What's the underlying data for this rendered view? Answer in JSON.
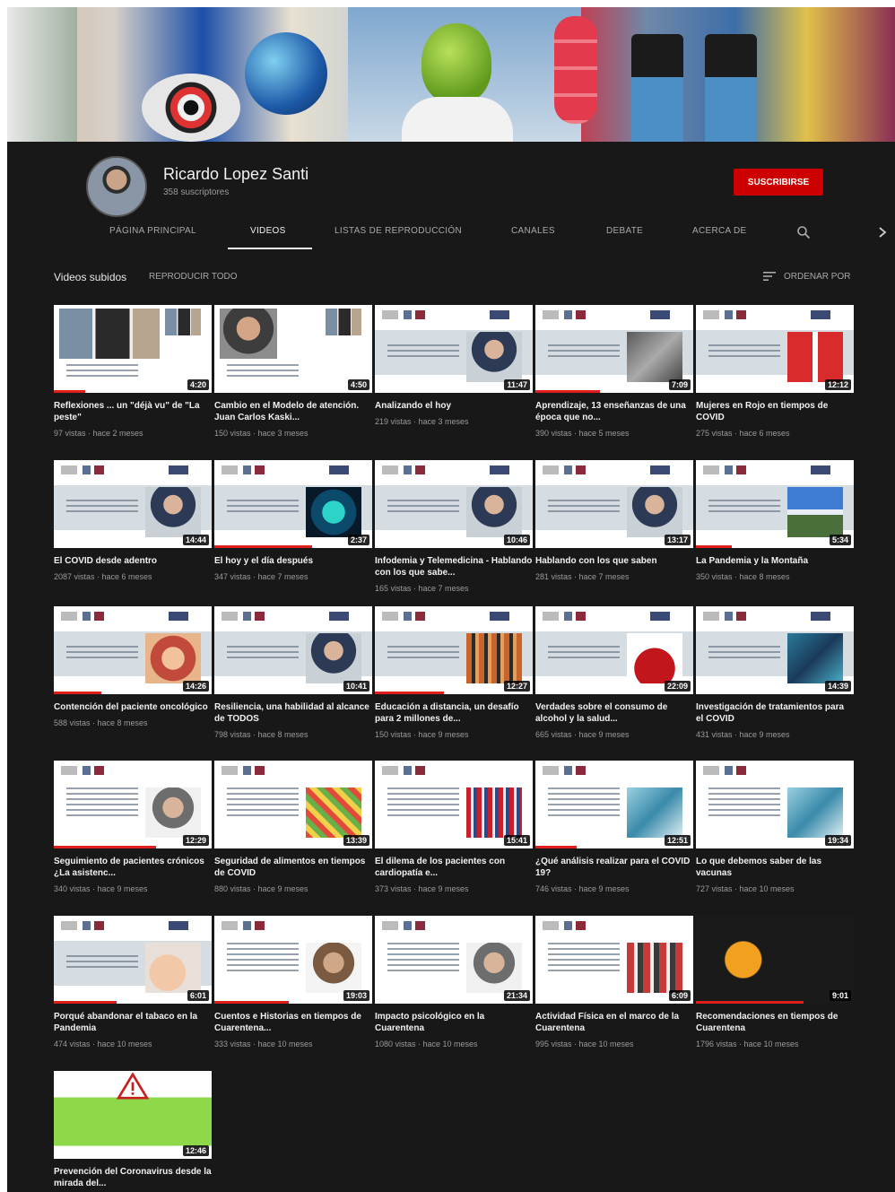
{
  "channel": {
    "name": "Ricardo Lopez Santi",
    "subscribers": "358 suscriptores",
    "subscribe_label": "SUSCRIBIRSE"
  },
  "tabs": [
    {
      "label": "PÁGINA PRINCIPAL"
    },
    {
      "label": "VIDEOS"
    },
    {
      "label": "LISTAS DE REPRODUCCIÓN"
    },
    {
      "label": "CANALES"
    },
    {
      "label": "DEBATE"
    },
    {
      "label": "ACERCA DE"
    }
  ],
  "section": {
    "title": "Videos subidos",
    "play_all": "REPRODUCIR TODO",
    "sort_label": "ORDENAR POR"
  },
  "colors": {
    "background": "#181818",
    "accent": "#cc0000",
    "text": "#f1f1f1",
    "muted": "#9a9a9a"
  },
  "videos": [
    {
      "title": "Reflexiones ... un \"déjà vu\" de \"La peste\"",
      "meta": "97 vistas · hace 2 meses",
      "duration": "4:20",
      "style": "photos"
    },
    {
      "title": "Cambio en el Modelo de atención. Juan Carlos Kaski...",
      "meta": "150 vistas · hace 3 meses",
      "duration": "4:50",
      "style": "portrait"
    },
    {
      "title": "Analizando el hoy",
      "meta": "219 vistas · hace 3 meses",
      "duration": "11:47",
      "style": "slide"
    },
    {
      "title": "Aprendizaje, 13 enseñanzas de una época que no...",
      "meta": "390 vistas · hace 5 meses",
      "duration": "7:09",
      "style": "slide-gray"
    },
    {
      "title": "Mujeres en Rojo en tiempos de COVID",
      "meta": "275 vistas · hace 6 meses",
      "duration": "12:12",
      "style": "slide-red"
    },
    {
      "title": "El COVID desde adentro",
      "meta": "2087 vistas · hace 6 meses",
      "duration": "14:44",
      "style": "slide"
    },
    {
      "title": "El hoy y el día después",
      "meta": "347 vistas · hace 7 meses",
      "duration": "2:37",
      "style": "slide-globe"
    },
    {
      "title": "Infodemia y Telemedicina - Hablando con los que sabe...",
      "meta": "165 vistas · hace 7 meses",
      "duration": "10:46",
      "style": "slide"
    },
    {
      "title": "Hablando con los que saben",
      "meta": "281 vistas · hace 7 meses",
      "duration": "13:17",
      "style": "slide"
    },
    {
      "title": "La Pandemia y la Montaña",
      "meta": "350 vistas · hace 8 meses",
      "duration": "5:34",
      "style": "slide-mountain"
    },
    {
      "title": "Contención del paciente oncológico",
      "meta": "588 vistas · hace 8 meses",
      "duration": "14:26",
      "style": "slide-hands"
    },
    {
      "title": "Resiliencia, una habilidad al alcance de TODOS",
      "meta": "798 vistas · hace 8 meses",
      "duration": "10:41",
      "style": "slide"
    },
    {
      "title": "Educación a distancia, un desafío para 2 millones de...",
      "meta": "150 vistas · hace 9 meses",
      "duration": "12:27",
      "style": "slide-crowd"
    },
    {
      "title": "Verdades sobre el consumo de alcohol y la salud...",
      "meta": "665 vistas · hace 9 meses",
      "duration": "22:09",
      "style": "slide-wine"
    },
    {
      "title": "Investigación de tratamientos para el COVID",
      "meta": "431 vistas · hace 9 meses",
      "duration": "14:39",
      "style": "slide-lab"
    },
    {
      "title": "Seguimiento de pacientes crónicos ¿La asistenc...",
      "meta": "340 vistas · hace 9 meses",
      "duration": "12:29",
      "style": "white"
    },
    {
      "title": "Seguridad de alimentos en tiempos de COVID",
      "meta": "880 vistas · hace 9 meses",
      "duration": "13:39",
      "style": "white-food"
    },
    {
      "title": "El dilema de los pacientes con cardiopatía e...",
      "meta": "373 vistas · hace 9 meses",
      "duration": "15:41",
      "style": "white-crowd"
    },
    {
      "title": "¿Qué análisis realizar para el COVID 19?",
      "meta": "746 vistas · hace 9 meses",
      "duration": "12:51",
      "style": "white-lab"
    },
    {
      "title": "Lo que debemos saber de las vacunas",
      "meta": "727 vistas · hace 10 meses",
      "duration": "19:34",
      "style": "white-lab"
    },
    {
      "title": "Porqué abandonar el tabaco en la Pandemia",
      "meta": "474 vistas · hace 10 meses",
      "duration": "6:01",
      "style": "slide-hand"
    },
    {
      "title": "Cuentos e Historias en tiempos de Cuarentena...",
      "meta": "333 vistas · hace 10 meses",
      "duration": "19:03",
      "style": "white-text"
    },
    {
      "title": "Impacto psicológico en la Cuarentena",
      "meta": "1080 vistas · hace 10 meses",
      "duration": "21:34",
      "style": "white"
    },
    {
      "title": "Actividad Física en el marco de la Cuarentena",
      "meta": "995 vistas · hace 10 meses",
      "duration": "6:09",
      "style": "white-group"
    },
    {
      "title": "Recomendaciones en tiempos de Cuarentena",
      "meta": "1796 vistas · hace 10 meses",
      "duration": "9:01",
      "style": "dark-food"
    },
    {
      "title": "Prevención del Coronavirus desde la mirada del...",
      "meta": "",
      "duration": "12:46",
      "style": "warning"
    }
  ]
}
